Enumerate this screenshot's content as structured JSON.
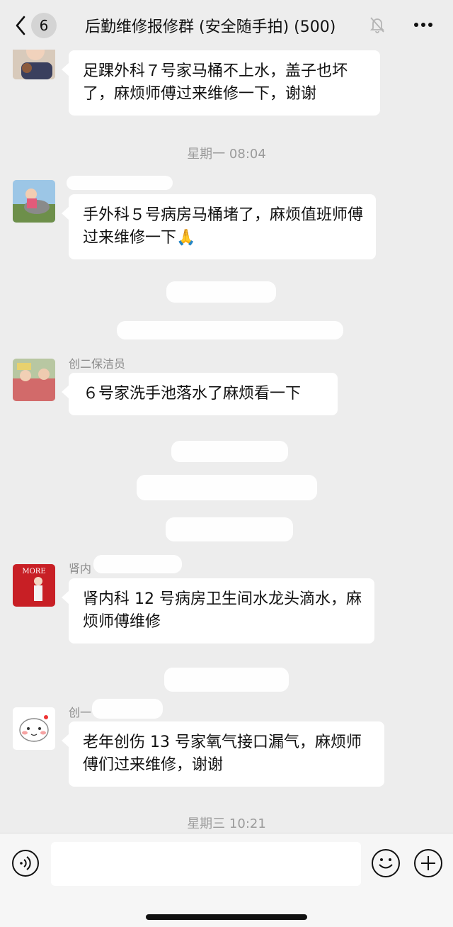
{
  "header": {
    "unread_count": "6",
    "title": "后勤维修报修群 (安全随手拍) (500)"
  },
  "messages": [
    {
      "text": "足踝外科７号家马桶不上水，盖子也坏了，麻烦师傅过来维修一下，谢谢"
    },
    {
      "time": "星期一 08:04"
    },
    {
      "sender": "",
      "text": "手外科５号病房马桶堵了，麻烦值班师傅过来维修一下🙏"
    },
    {
      "sender": "创二保洁员",
      "text": "６号家洗手池落水了麻烦看一下"
    },
    {
      "sender": "肾内",
      "text": "肾内科 12 号病房卫生间水龙头滴水，麻烦师傅维修"
    },
    {
      "sender": "创一",
      "text": "老年创伤 13 号家氧气接口漏气，麻烦师傅们过来维修，谢谢"
    },
    {
      "time": "星期三 10:21"
    }
  ],
  "avatar_texts": {
    "more_logo": "MORE"
  },
  "composer": {
    "placeholder": ""
  },
  "icons": [
    "back-chevron-icon",
    "mute-bell-icon",
    "more-dots-icon",
    "voice-icon",
    "emoji-icon",
    "plus-icon"
  ]
}
